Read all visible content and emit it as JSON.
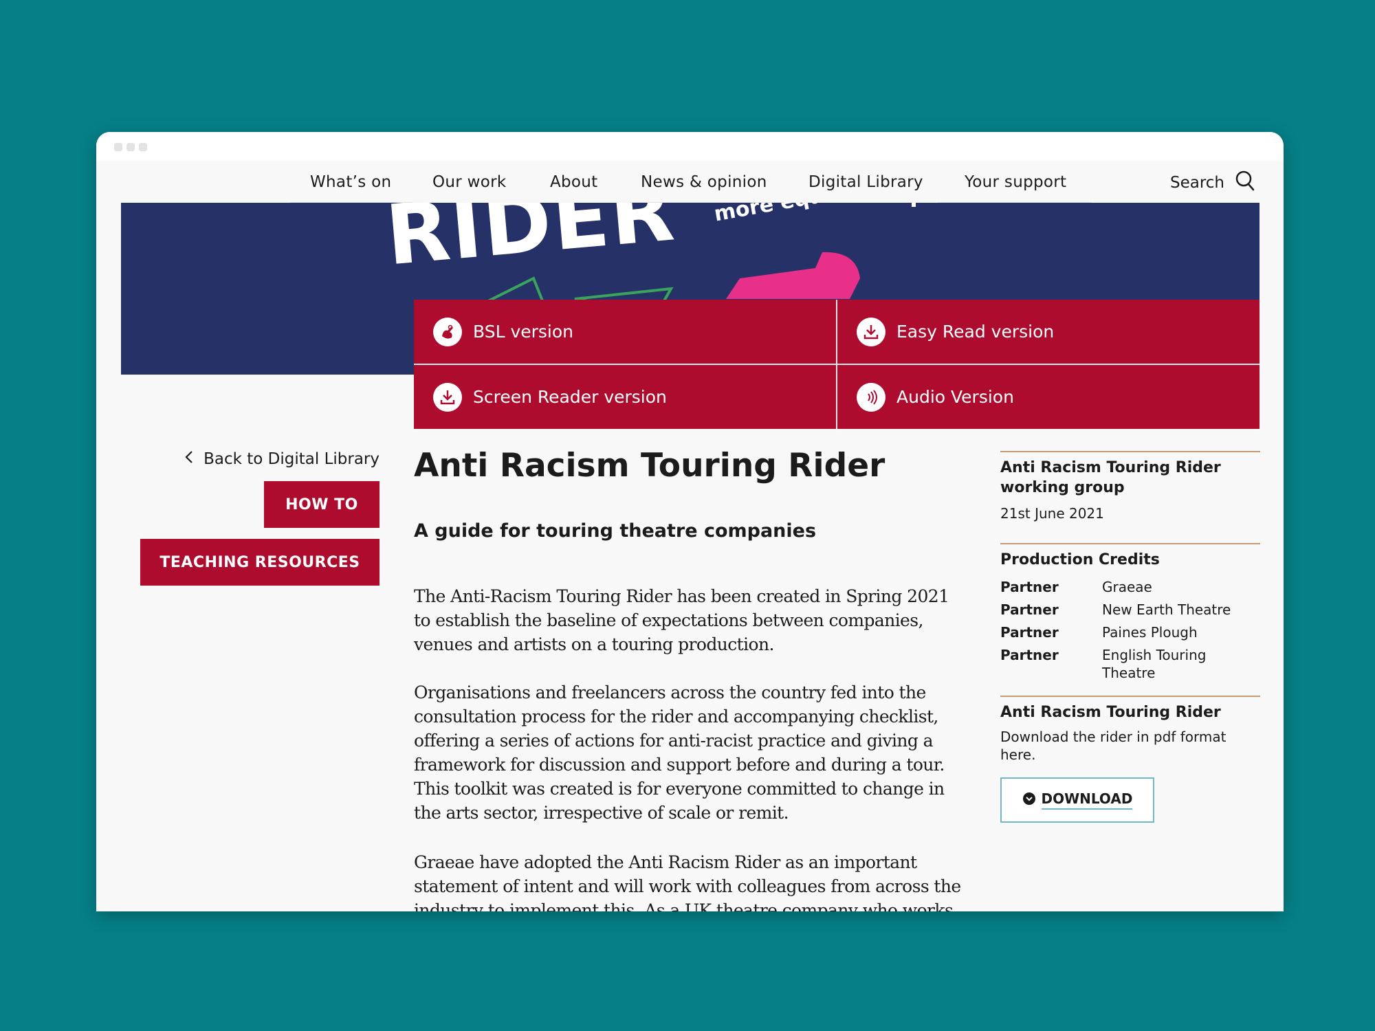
{
  "nav": {
    "items": [
      {
        "label": "What’s on"
      },
      {
        "label": "Our work"
      },
      {
        "label": "About"
      },
      {
        "label": "News & opinion"
      },
      {
        "label": "Digital Library"
      },
      {
        "label": "Your support"
      }
    ],
    "search_label": "Search"
  },
  "hero": {
    "banner_word": "RIDER",
    "banner_sub": "more equitable"
  },
  "versions": [
    {
      "label": "BSL version",
      "icon": "sign-language-icon"
    },
    {
      "label": "Easy Read version",
      "icon": "download-icon"
    },
    {
      "label": "Screen Reader version",
      "icon": "download-icon"
    },
    {
      "label": "Audio Version",
      "icon": "audio-icon"
    }
  ],
  "left": {
    "back_label": "Back to Digital Library",
    "tags": [
      "HOW TO",
      "TEACHING RESOURCES"
    ]
  },
  "article": {
    "title": "Anti Racism Touring Rider",
    "subtitle": "A guide for touring theatre companies",
    "paragraphs": [
      "The Anti-Racism Touring Rider has been created in Spring 2021 to establish the baseline of expectations between companies, venues and artists on a touring production.",
      "Organisations and freelancers across the country fed into the consultation process for the rider and accompanying checklist, offering a series of actions for anti-racist practice and giving a framework for discussion and support before and during a tour. This toolkit was created is for everyone committed to change in the arts sector, irrespective of scale or remit.",
      "Graeae have adopted the Anti Racism Rider as an important statement of intent and will work with colleagues from across the industry to implement this. As a UK theatre company who works in a community that"
    ]
  },
  "sidebar": {
    "author": "Anti Racism Touring Rider working group",
    "date": "21st June 2021",
    "credits_heading": "Production Credits",
    "credits": [
      {
        "role": "Partner",
        "name": "Graeae"
      },
      {
        "role": "Partner",
        "name": "New Earth Theatre"
      },
      {
        "role": "Partner",
        "name": "Paines Plough"
      },
      {
        "role": "Partner",
        "name": "English Touring Theatre"
      }
    ],
    "download_heading": "Anti Racism Touring Rider",
    "download_text": "Download the rider in pdf format here.",
    "download_label": "DOWNLOAD"
  },
  "colors": {
    "background": "#067f87",
    "accent_red": "#ad0c2e",
    "hero_navy": "#263167",
    "rule_tan": "#c59a72"
  }
}
